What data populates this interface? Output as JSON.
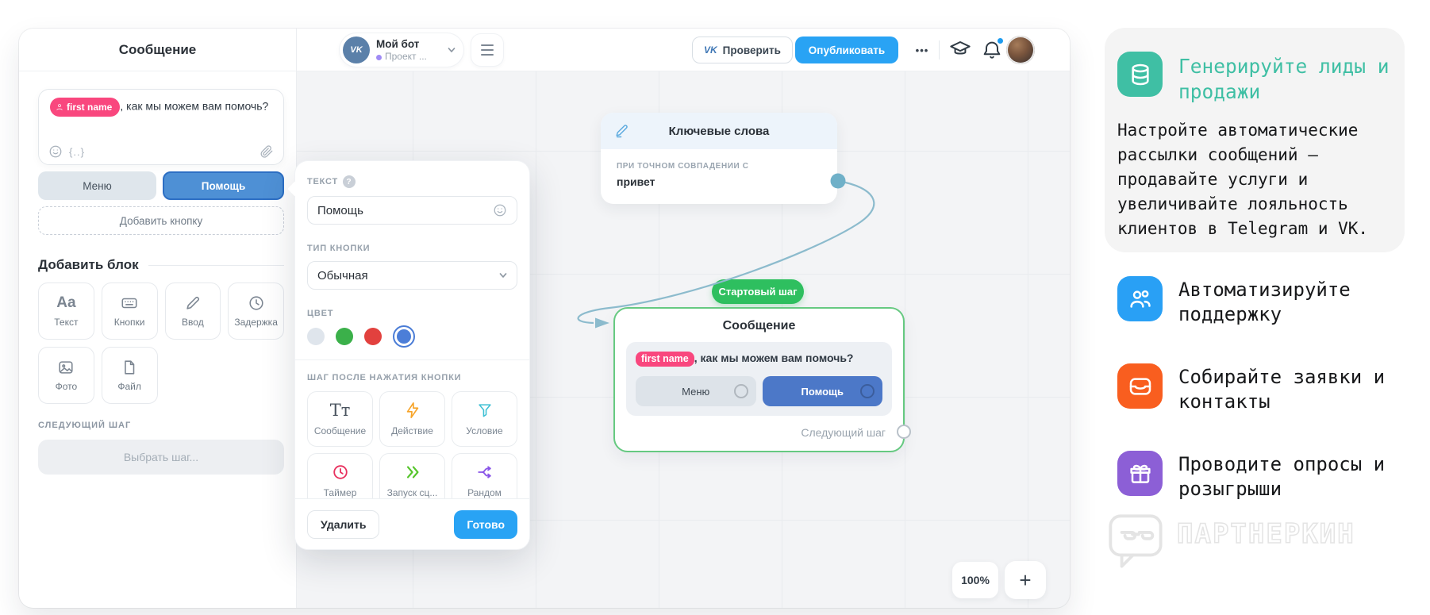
{
  "app": {
    "topbar": {
      "vk": "VK",
      "bot_name": "Мой бот",
      "project": "Проект ...",
      "verify": "Проверить",
      "publish": "Опубликовать",
      "more": "•••"
    },
    "sidebar": {
      "title": "Сообщение",
      "message": {
        "tag": "first name",
        "text": ", как мы можем вам помочь?",
        "vars_glyph": "{..}"
      },
      "buttons": {
        "menu": "Меню",
        "help": "Помощь"
      },
      "add_button": "Добавить кнопку",
      "add_block": "Добавить блок",
      "blocks": [
        {
          "label": "Текст"
        },
        {
          "label": "Кнопки"
        },
        {
          "label": "Ввод"
        },
        {
          "label": "Задержка"
        },
        {
          "label": "Фото"
        },
        {
          "label": "Файл"
        }
      ],
      "next_step_label": "СЛЕДУЮЩИЙ ШАГ",
      "choose_step": "Выбрать шаг..."
    },
    "popup": {
      "text_label": "ТЕКСТ",
      "help_glyph": "?",
      "text_value": "Помощь",
      "type_label": "ТИП КНОПКИ",
      "type_value": "Обычная",
      "color_label": "ЦВЕТ",
      "colors": {
        "gray": "#dfe5ec",
        "green": "#3bb04a",
        "red": "#e2413e",
        "blue": "#4c7ed8"
      },
      "step_label": "ШАГ ПОСЛЕ НАЖАТИЯ КНОПКИ",
      "steps": [
        {
          "label": "Сообщение"
        },
        {
          "label": "Действие"
        },
        {
          "label": "Условие"
        },
        {
          "label": "Таймер"
        },
        {
          "label": "Запуск сц..."
        },
        {
          "label": "Рандом"
        }
      ],
      "delete": "Удалить",
      "done": "Готово"
    },
    "canvas": {
      "keywords": {
        "title": "Ключевые слова",
        "condition": "ПРИ ТОЧНОМ СОВПАДЕНИИ С",
        "keyword": "привет"
      },
      "start_badge": "Стартовый шаг",
      "message_node": {
        "title": "Сообщение",
        "tag": "first name",
        "text": ", как мы можем вам помочь?",
        "menu": "Меню",
        "help": "Помощь",
        "next_step": "Следующий шаг"
      },
      "zoom": "100%",
      "zoom_in": "+"
    }
  },
  "promo": {
    "lead_card": {
      "title": "Генерируйте лиды и продажи",
      "body": "Настройте автоматические рассылки сообщений — продавайте услуги и увеличивайте лояльность клиентов в Telegram и VK.",
      "accent": "#3fbfa4"
    },
    "items": [
      {
        "label": "Автоматизируйте поддержку",
        "color": "#29a0f5"
      },
      {
        "label": "Собирайте заявки и контакты",
        "color": "#f95e1f"
      },
      {
        "label": "Проводите опросы и розыгрыши",
        "color": "#8c5fd6"
      }
    ],
    "watermark": "ПАРТНЕРКИН"
  }
}
